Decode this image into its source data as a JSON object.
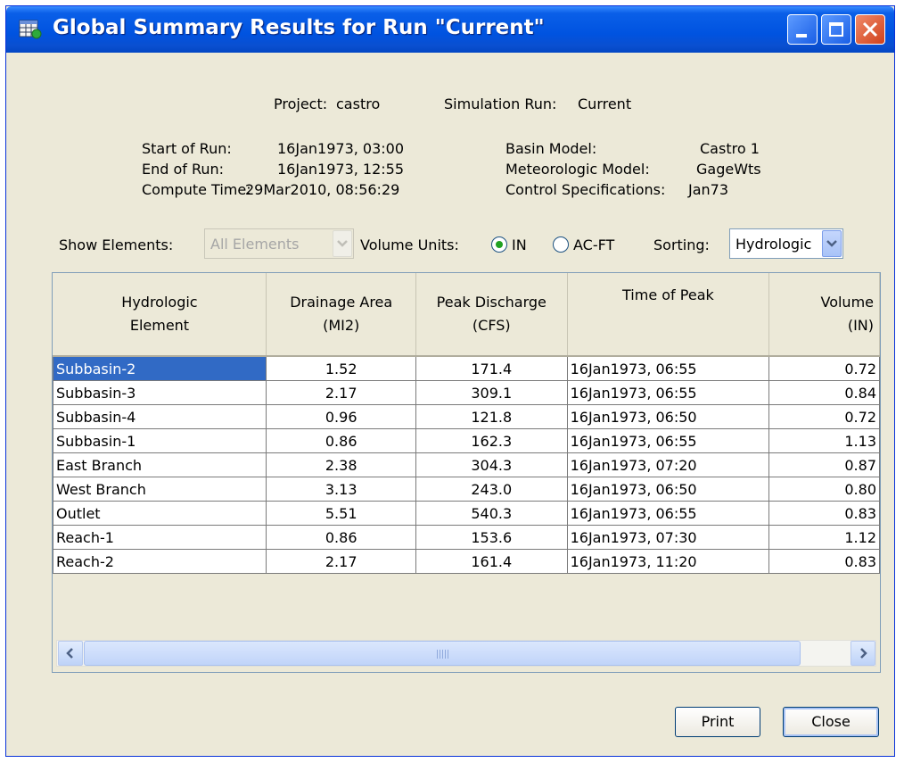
{
  "window": {
    "title": "Global Summary Results for Run \"Current\""
  },
  "summary": {
    "project_label": "Project:",
    "project": "castro",
    "run_label": "Simulation Run:",
    "run": "Current",
    "start_label": "Start of Run:",
    "start": "16Jan1973, 03:00",
    "end_label": "End of Run:",
    "end": "16Jan1973, 12:55",
    "compute_label": "Compute Time:",
    "compute": "29Mar2010, 08:56:29",
    "basin_label": "Basin Model:",
    "basin": "Castro 1",
    "met_label": "Meteorologic Model:",
    "met": "GageWts",
    "control_label": "Control Specifications:",
    "control": "Jan73"
  },
  "controls": {
    "show_label": "Show Elements:",
    "show_value": "All Elements",
    "volume_label": "Volume Units:",
    "in_label": "IN",
    "acft_label": "AC-FT",
    "volume_selected": "IN",
    "sort_label": "Sorting:",
    "sort_value": "Hydrologic"
  },
  "table": {
    "headers": [
      {
        "line1": "Hydrologic",
        "line2": "Element"
      },
      {
        "line1": "Drainage Area",
        "line2": "(MI2)"
      },
      {
        "line1": "Peak Discharge",
        "line2": "(CFS)"
      },
      {
        "line1": "Time of Peak",
        "line2": ""
      },
      {
        "line1": "Volume",
        "line2": "(IN)"
      }
    ],
    "rows": [
      [
        "Subbasin-2",
        "1.52",
        "171.4",
        "16Jan1973, 06:55",
        "0.72"
      ],
      [
        "Subbasin-3",
        "2.17",
        "309.1",
        "16Jan1973, 06:55",
        "0.84"
      ],
      [
        "Subbasin-4",
        "0.96",
        "121.8",
        "16Jan1973, 06:50",
        "0.72"
      ],
      [
        "Subbasin-1",
        "0.86",
        "162.3",
        "16Jan1973, 06:55",
        "1.13"
      ],
      [
        "East Branch",
        "2.38",
        "304.3",
        "16Jan1973, 07:20",
        "0.87"
      ],
      [
        "West Branch",
        "3.13",
        "243.0",
        "16Jan1973, 06:50",
        "0.80"
      ],
      [
        "Outlet",
        "5.51",
        "540.3",
        "16Jan1973, 06:55",
        "0.83"
      ],
      [
        "Reach-1",
        "0.86",
        "153.6",
        "16Jan1973, 07:30",
        "1.12"
      ],
      [
        "Reach-2",
        "2.17",
        "161.4",
        "16Jan1973, 11:20",
        "0.83"
      ]
    ]
  },
  "buttons": {
    "print": "Print",
    "close": "Close"
  },
  "colors": {
    "titlebar": "#0053e0",
    "selection": "#316ac5",
    "window_bg": "#ece9d8"
  }
}
